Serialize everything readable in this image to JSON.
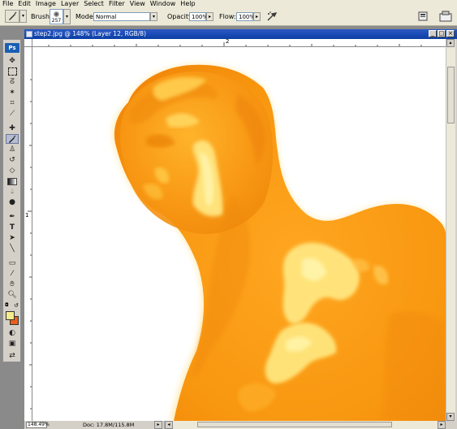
{
  "menu": [
    "File",
    "Edit",
    "Image",
    "Layer",
    "Select",
    "Filter",
    "View",
    "Window",
    "Help"
  ],
  "options": {
    "brush_label": "Brush:",
    "brush_size": "257",
    "mode_label": "Mode:",
    "mode_value": "Normal",
    "opacity_label": "Opacity:",
    "opacity_value": "100%",
    "flow_label": "Flow:",
    "flow_value": "100%",
    "icons": [
      "brush-tool-icon",
      "airbrush-icon",
      "file-browser-icon",
      "palette-well-icon"
    ]
  },
  "toolbox": {
    "logo": "Ps",
    "tools": [
      "move",
      "marquee",
      "lasso",
      "magic-wand",
      "crop",
      "slice",
      "healing",
      "brush",
      "stamp",
      "history-brush",
      "eraser",
      "gradient",
      "blur",
      "dodge",
      "pen",
      "type",
      "path-select",
      "line",
      "notes",
      "eyedropper",
      "hand",
      "zoom"
    ],
    "selected_tool": "brush",
    "foreground_color": "#f5ec8c",
    "background_color": "#e8601a"
  },
  "document": {
    "title": "step2.jpg @ 148% (Layer 12, RGB/8)",
    "ruler_top_mark": "2",
    "ruler_left_mark": "1",
    "zoom": "148.49%",
    "doc_info": "Doc: 17.8M/115.8M"
  },
  "colors": {
    "figure_base": "#f79a17",
    "figure_highlight": "#ffd660",
    "figure_light": "#fff0a0",
    "title_bar": "#0b3fa4"
  }
}
